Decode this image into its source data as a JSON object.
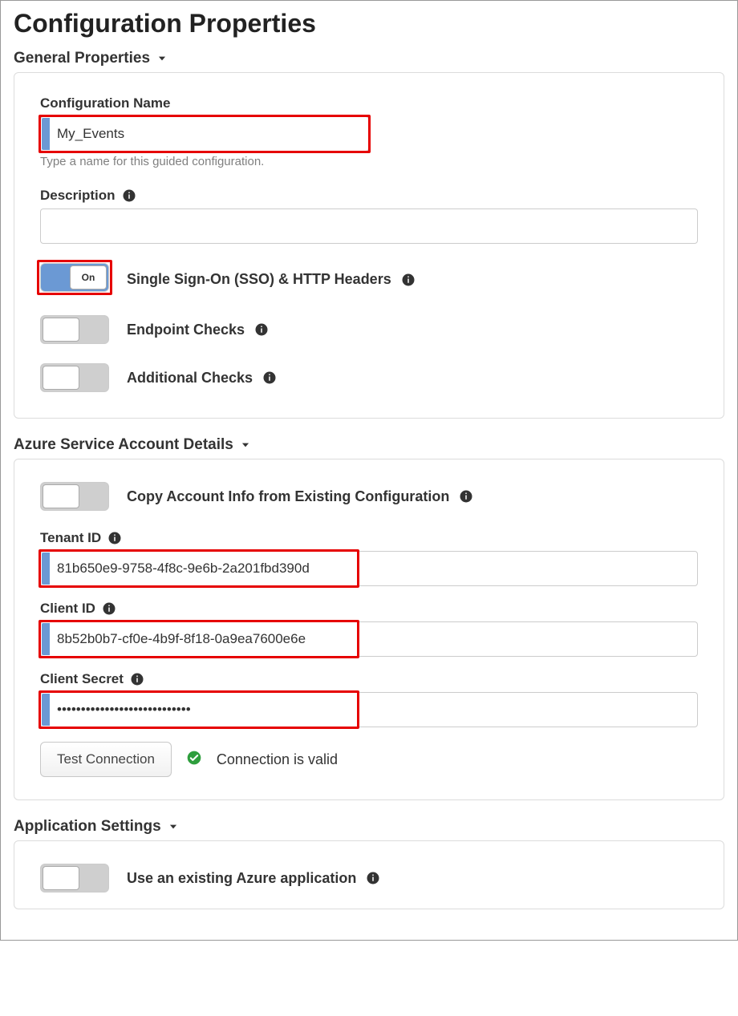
{
  "page_title": "Configuration Properties",
  "sections": {
    "general": {
      "header": "General Properties",
      "config_name_label": "Configuration Name",
      "config_name_value": "My_Events",
      "config_name_help": "Type a name for this guided configuration.",
      "description_label": "Description",
      "description_value": "",
      "toggle_on_text": "On",
      "sso_label": "Single Sign-On (SSO) & HTTP Headers",
      "endpoint_label": "Endpoint Checks",
      "additional_label": "Additional Checks"
    },
    "azure": {
      "header": "Azure Service Account Details",
      "copy_label": "Copy Account Info from Existing Configuration",
      "tenant_label": "Tenant ID",
      "tenant_value": "81b650e9-9758-4f8c-9e6b-2a201fbd390d",
      "client_id_label": "Client ID",
      "client_id_value": "8b52b0b7-cf0e-4b9f-8f18-0a9ea7600e6e",
      "client_secret_label": "Client Secret",
      "client_secret_value": "••••••••••••••••••••••••••••",
      "test_btn": "Test Connection",
      "conn_status": "Connection is valid"
    },
    "app": {
      "header": "Application Settings",
      "use_existing_label": "Use an existing Azure application"
    }
  }
}
